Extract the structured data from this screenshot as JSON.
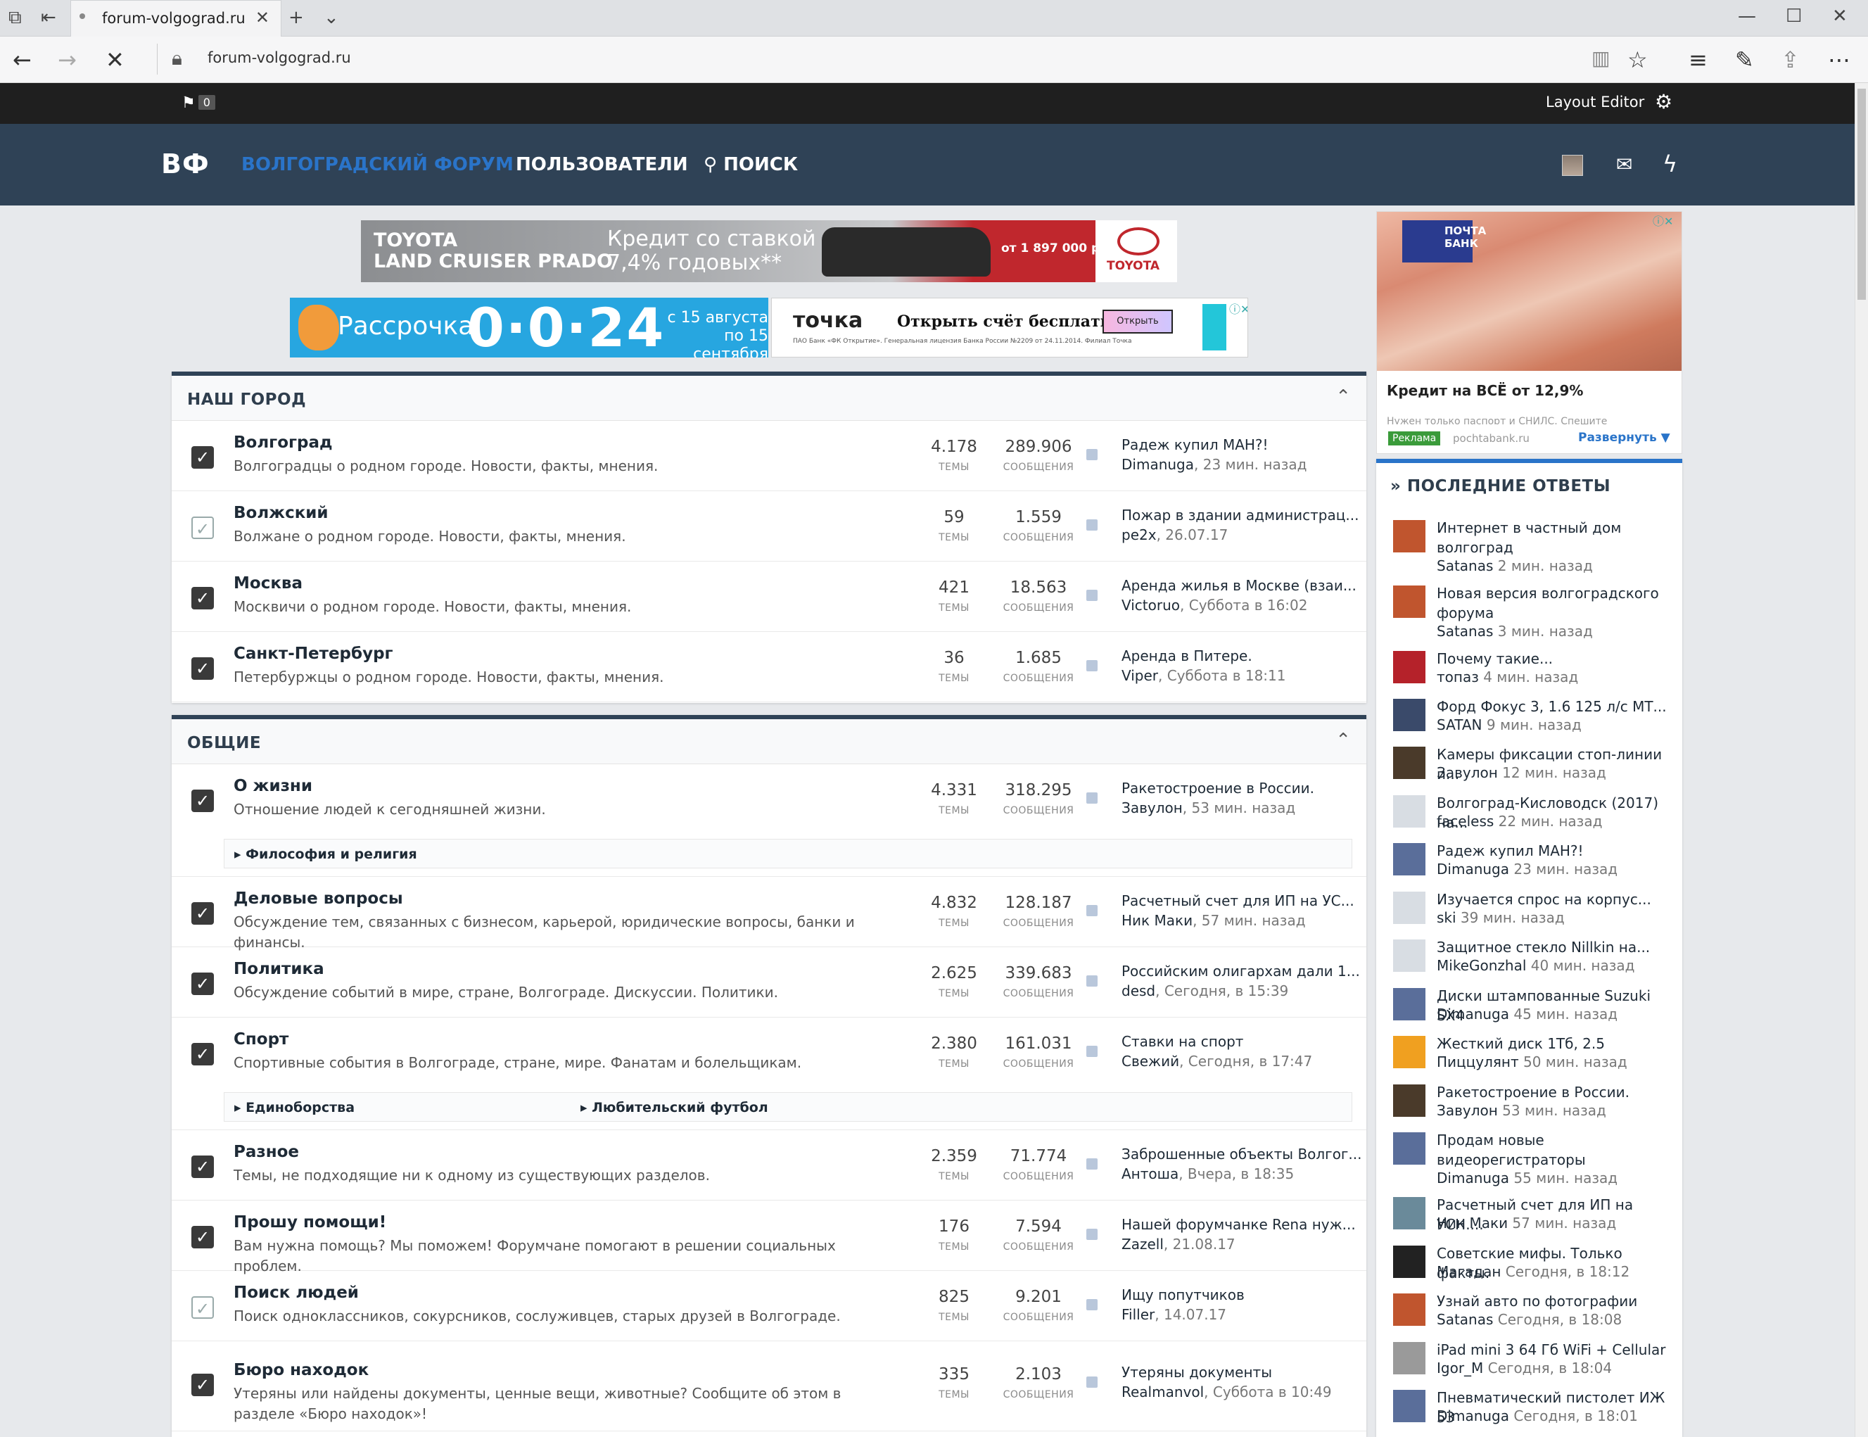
{
  "browser": {
    "tab_title": "forum-volgograd.ru",
    "url": "forum-volgograd.ru"
  },
  "topbar": {
    "flag_count": "0",
    "layout_editor": "Layout Editor"
  },
  "header": {
    "logo": "ВФ",
    "nav": [
      "ВОЛГОГРАДСКИЙ ФОРУМ",
      "ПОЛЬЗОВАТЕЛИ",
      "ПОИСК"
    ],
    "accent": "#2a74c9",
    "bg": "#2f4256"
  },
  "ads": {
    "toyota": {
      "line1": "TOYOTA",
      "line2": "LAND CRUISER PRADO",
      "offer1": "Кредит со ставкой",
      "offer2": "7,4% годовых**",
      "price": "от 1 897 000 р*",
      "brand": "TOYOTA"
    },
    "rassrochka": {
      "a": "Рассрочка",
      "b": "0·0·24",
      "c1": "с 15 августа",
      "c2": "по 15 сентября"
    },
    "tochka": {
      "a": "точка",
      "b": "Открыть счёт бесплатно",
      "btn": "Открыть",
      "small": "ПАО Банк «ФК Открытие». Генеральная лицензия Банка России №2209 от 24.11.2014. Филиал Точка"
    },
    "side": {
      "bank": "ПОЧТА БАНК",
      "title": "Кредит на ВСЁ от 12,9%",
      "sub": "Нужен только паспорт и СНИЛС. Спешите",
      "reklama": "Реклама",
      "domain": "pochtabank.ru",
      "more": "Развернуть ▼"
    }
  },
  "labels": {
    "topics": "ТЕМЫ",
    "messages": "СООБЩЕНИЯ"
  },
  "sections": [
    {
      "title": "НАШ ГОРОД",
      "forums": [
        {
          "name": "Волгоград",
          "desc": "Волгоградцы о родном городе. Новости, факты, мнения.",
          "topics": "4.178",
          "messages": "289.906",
          "last_title": "Радеж купил МАН?!",
          "last_user": "Dimanuga",
          "last_time": ", 23 мин. назад",
          "read": false
        },
        {
          "name": "Волжский",
          "desc": "Волжане о родном городе. Новости, факты, мнения.",
          "topics": "59",
          "messages": "1.559",
          "last_title": "Пожар в здании администрац...",
          "last_user": "pe2x",
          "last_time": ", 26.07.17",
          "read": true
        },
        {
          "name": "Москва",
          "desc": "Москвичи о родном городе. Новости, факты, мнения.",
          "topics": "421",
          "messages": "18.563",
          "last_title": "Аренда жилья в Москве (взаи...",
          "last_user": "Victoruo",
          "last_time": ", Суббота в 16:02",
          "read": false
        },
        {
          "name": "Санкт-Петербург",
          "desc": "Петербуржцы о родном городе. Новости, факты, мнения.",
          "topics": "36",
          "messages": "1.685",
          "last_title": "Аренда в Питере.",
          "last_user": "Viper",
          "last_time": ", Суббота в 18:11",
          "read": false
        }
      ]
    },
    {
      "title": "ОБЩИЕ",
      "forums": [
        {
          "name": "О жизни",
          "desc": "Отношение людей к сегодняшней жизни.",
          "topics": "4.331",
          "messages": "318.295",
          "last_title": "Ракетостроение в России.",
          "last_user": "Завулон",
          "last_time": ", 53 мин. назад",
          "read": false,
          "subs": [
            "Философия и религия"
          ]
        },
        {
          "name": "Деловые вопросы",
          "desc": "Обсуждение тем, связанных с бизнесом, карьерой, юридические вопросы, банки и финансы.",
          "topics": "4.832",
          "messages": "128.187",
          "last_title": "Расчетный счет для ИП на УС...",
          "last_user": "Ник Маки",
          "last_time": ", 57 мин. назад",
          "read": false
        },
        {
          "name": "Политика",
          "desc": "Обсуждение событий в мире, стране, Волгограде. Дискуссии. Политики.",
          "topics": "2.625",
          "messages": "339.683",
          "last_title": "Российским олигархам дали 1...",
          "last_user": "desd",
          "last_time": ", Сегодня, в 15:39",
          "read": false
        },
        {
          "name": "Спорт",
          "desc": "Спортивные события в Волгограде, стране, мире. Фанатам и болельщикам.",
          "topics": "2.380",
          "messages": "161.031",
          "last_title": "Ставки на спорт",
          "last_user": "Свежий",
          "last_time": ", Сегодня, в 17:47",
          "read": false,
          "subs": [
            "Единоборства",
            "Любительский футбол"
          ]
        },
        {
          "name": "Разное",
          "desc": "Темы, не подходящие ни к одному из существующих разделов.",
          "topics": "2.359",
          "messages": "71.774",
          "last_title": "Заброшенные объекты Волгог...",
          "last_user": "Антоша",
          "last_time": ", Вчера, в 18:35",
          "read": false
        },
        {
          "name": "Прошу помощи!",
          "desc": "Вам нужна помощь? Мы поможем! Форумчане помогают в решении социальных проблем.",
          "topics": "176",
          "messages": "7.594",
          "last_title": "Нашей форумчанке Rena нуж...",
          "last_user": "Zazell",
          "last_time": ", 21.08.17",
          "read": false
        },
        {
          "name": "Поиск людей",
          "desc": "Поиск одноклассников, сокурсников, сослуживцев, старых друзей в Волгограде.",
          "topics": "825",
          "messages": "9.201",
          "last_title": "Ищу попутчиков",
          "last_user": "Filler",
          "last_time": ", 14.07.17",
          "read": true
        },
        {
          "name": "Бюро находок",
          "desc": "Утеряны или найдены документы, ценные вещи, животные? Сообщите об этом в разделе «Бюро находок»!",
          "topics": "335",
          "messages": "2.103",
          "last_title": "Утеряны документы",
          "last_user": "Realmanvol",
          "last_time": ", Суббота в 10:49",
          "read": false
        }
      ]
    }
  ],
  "recent": {
    "title": "ПОСЛЕДНИЕ ОТВЕТЫ",
    "items": [
      {
        "title": "Интернет в частный дом волгоград",
        "user": "Satanas",
        "time": " 2 мин. назад",
        "color": "#c0552e"
      },
      {
        "title": "Новая версия волгоградского форума",
        "user": "Satanas",
        "time": " 3 мин. назад",
        "color": "#c0552e"
      },
      {
        "title": "Почему такие...",
        "user": "топаз",
        "time": " 4 мин. назад",
        "color": "#b5222a"
      },
      {
        "title": "Форд Фокус 3, 1.6 125 л/с МТ...",
        "user": "SATAN",
        "time": " 9 мин. назад",
        "color": "#3a4a6a"
      },
      {
        "title": "Камеры фиксации стоп-линии и...",
        "user": "Завулон",
        "time": " 12 мин. назад",
        "color": "#4a3a2a"
      },
      {
        "title": "Волгоград-Кисловодск (2017) на...",
        "user": "faceless",
        "time": " 22 мин. назад",
        "color": "#d8dde3"
      },
      {
        "title": "Радеж купил МАН?!",
        "user": "Dimanuga",
        "time": " 23 мин. назад",
        "color": "#5a6e9a"
      },
      {
        "title": "Изучается спрос на корпус...",
        "user": "ski",
        "time": " 39 мин. назад",
        "color": "#d8dde3"
      },
      {
        "title": "Защитное стекло Nillkin на...",
        "user": "MikeGonzhal",
        "time": " 40 мин. назад",
        "color": "#d8dde3"
      },
      {
        "title": "Диски штампованные Suzuki SX4",
        "user": "Dimanuga",
        "time": " 45 мин. назад",
        "color": "#5a6e9a"
      },
      {
        "title": "Жесткий диск 1Тб, 2.5",
        "user": "Пиццулянт",
        "time": " 50 мин. назад",
        "color": "#f0a020"
      },
      {
        "title": "Ракетостроение в России.",
        "user": "Завулон",
        "time": " 53 мин. назад",
        "color": "#4a3a2a"
      },
      {
        "title": "Продам новые видеорегистраторы",
        "user": "Dimanuga",
        "time": " 55 мин. назад",
        "color": "#5a6e9a"
      },
      {
        "title": "Расчетный счет для ИП на УСН....",
        "user": "Ник Маки",
        "time": " 57 мин. назад",
        "color": "#6a8a9a"
      },
      {
        "title": "Советские мифы. Только факты.",
        "user": "Магадан",
        "time": " Сегодня, в 18:12",
        "color": "#222222"
      },
      {
        "title": "Узнай авто по фотографии",
        "user": "Satanas",
        "time": " Сегодня, в 18:08",
        "color": "#c0552e"
      },
      {
        "title": "iPad mini 3 64 Гб WiFi + Cellular",
        "user": "Igor_M",
        "time": " Сегодня, в 18:04",
        "color": "#9a9a9a"
      },
      {
        "title": "Пневматический пистолет ИЖ 53",
        "user": "Dimanuga",
        "time": " Сегодня, в 18:01",
        "color": "#5a6e9a"
      }
    ]
  }
}
